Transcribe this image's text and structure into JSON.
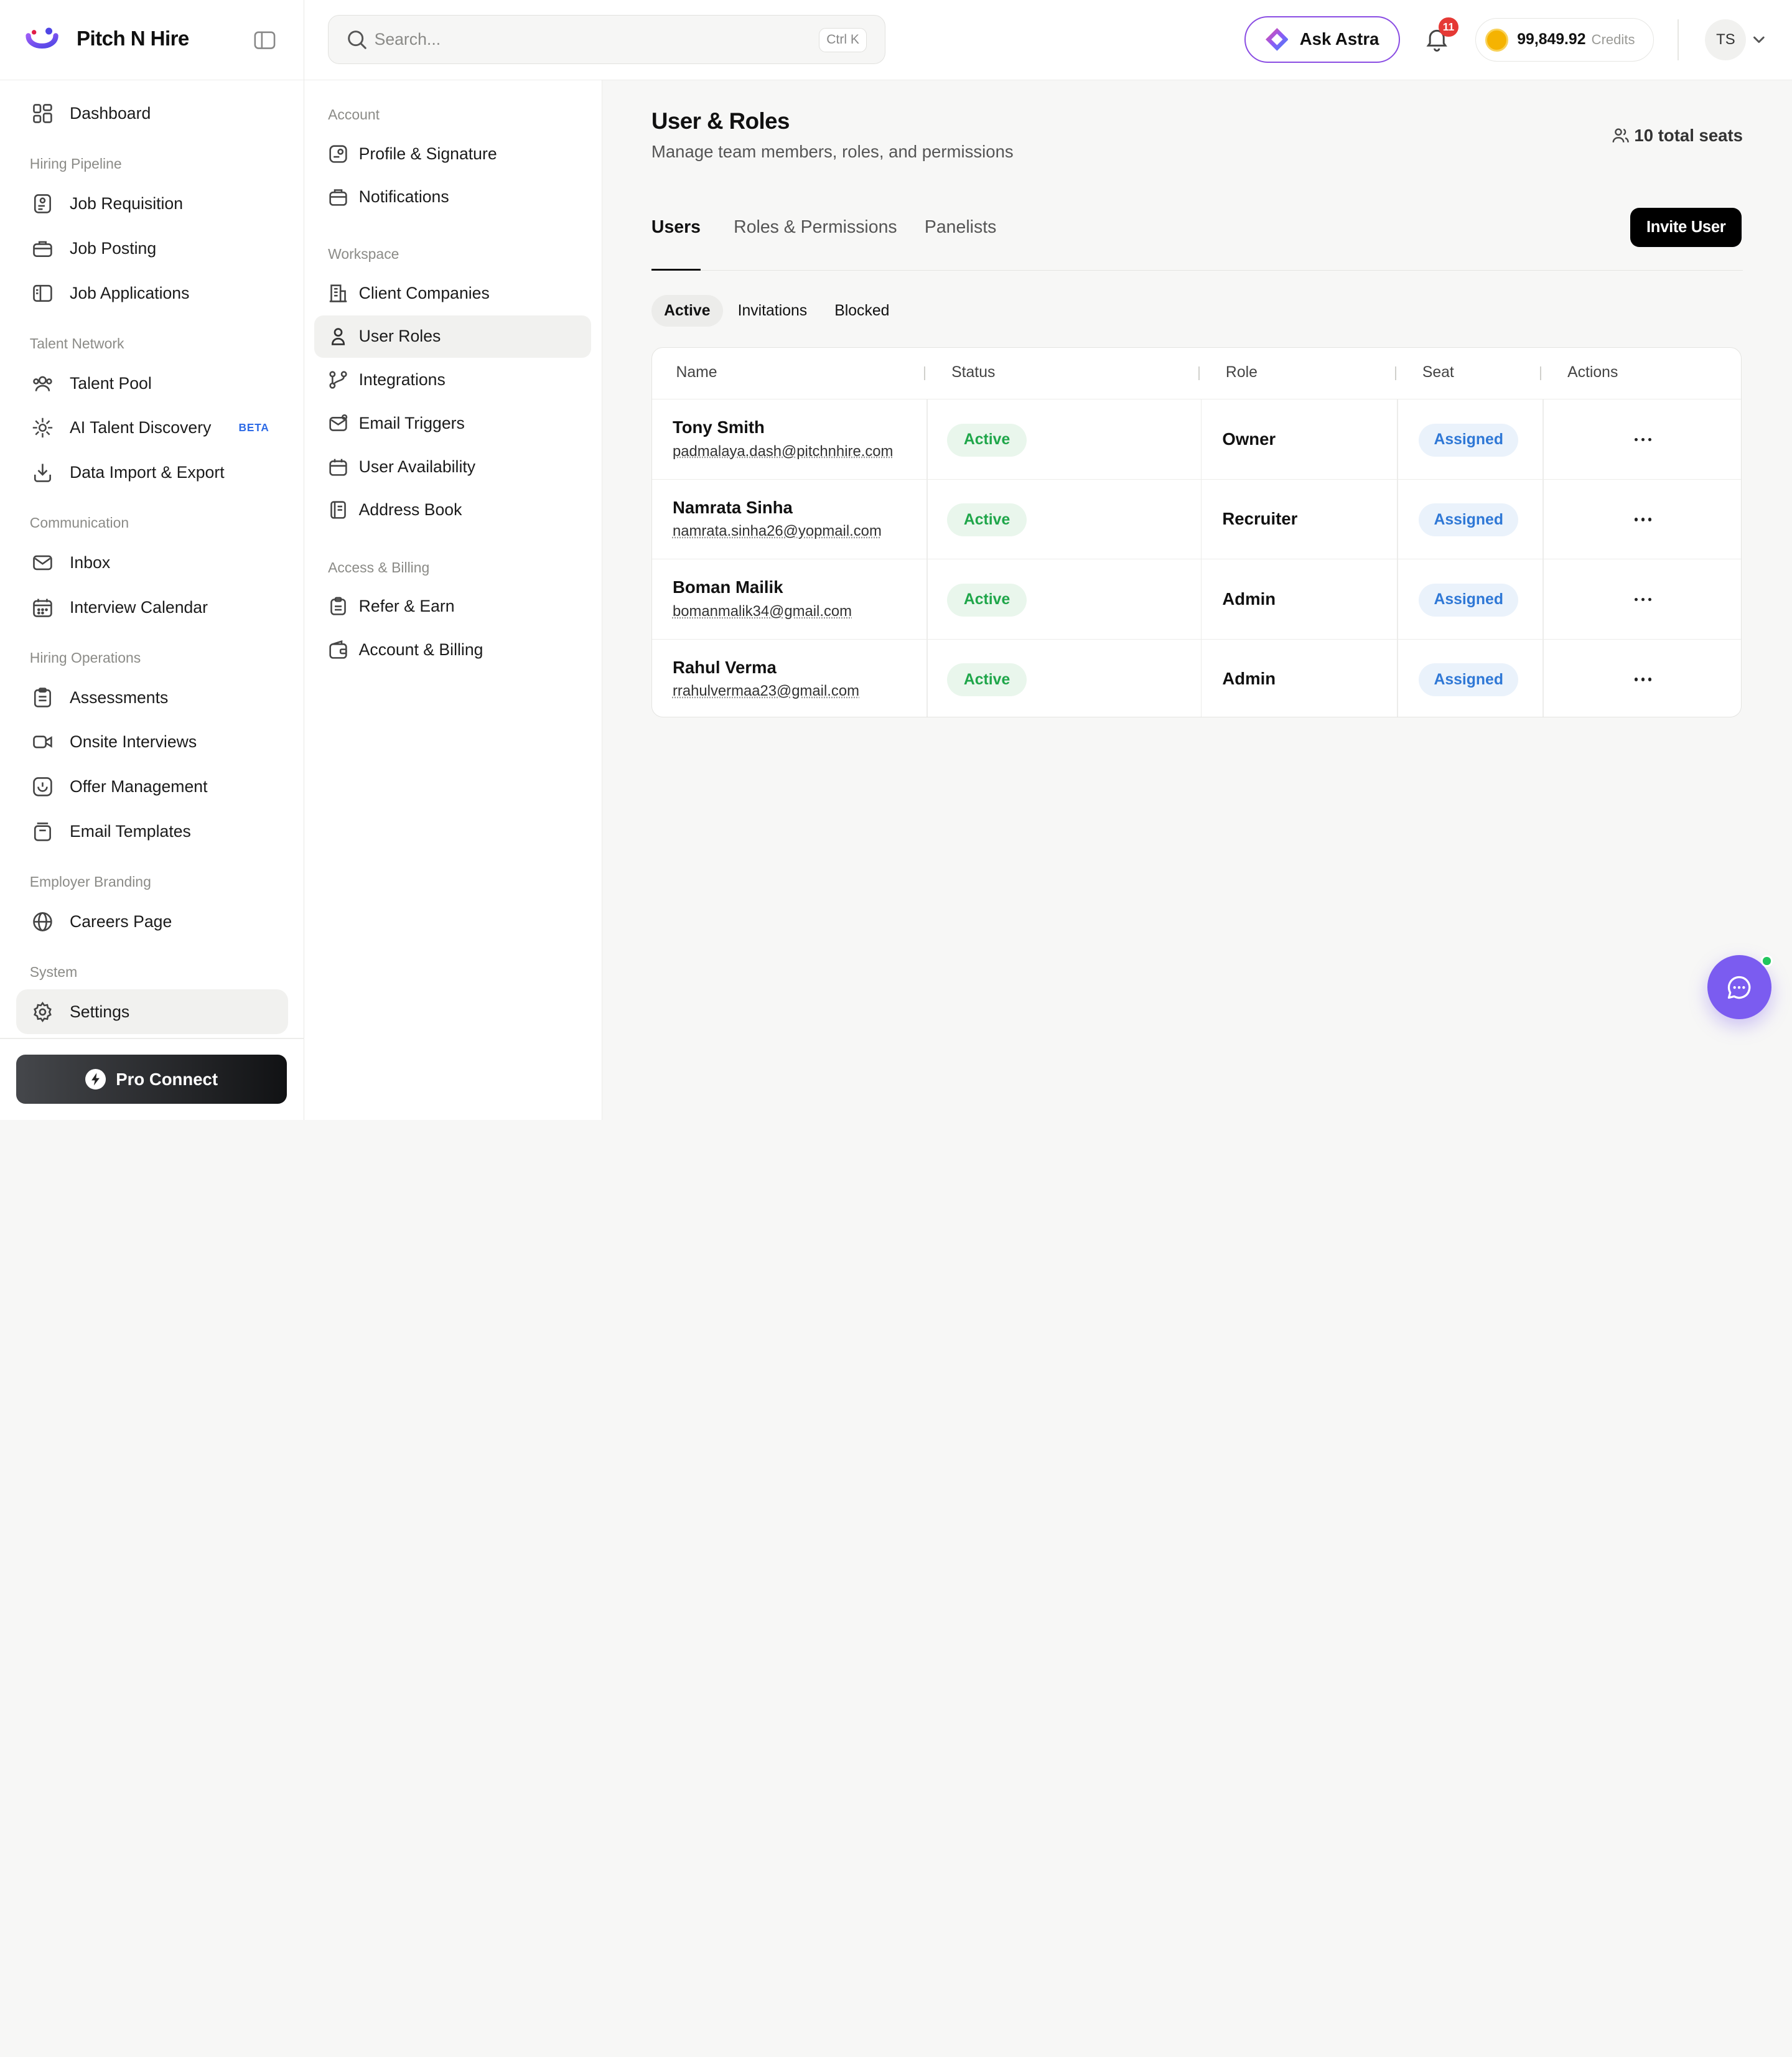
{
  "brand": {
    "name": "Pitch N Hire"
  },
  "sidebar": {
    "dashboard": "Dashboard",
    "sections": [
      {
        "title": "Hiring Pipeline",
        "items": [
          "Job Requisition",
          "Job Posting",
          "Job Applications"
        ]
      },
      {
        "title": "Talent Network",
        "items": [
          "Talent Pool",
          "AI Talent Discovery",
          "Data Import & Export"
        ],
        "beta_label": "BETA"
      },
      {
        "title": "Communication",
        "items": [
          "Inbox",
          "Interview Calendar"
        ]
      },
      {
        "title": "Hiring Operations",
        "items": [
          "Assessments",
          "Onsite Interviews",
          "Offer Management",
          "Email Templates"
        ]
      },
      {
        "title": "Employer Branding",
        "items": [
          "Careers Page"
        ]
      },
      {
        "title": "System",
        "items": [
          "Settings"
        ]
      }
    ],
    "pro_connect": "Pro Connect"
  },
  "topbar": {
    "search_placeholder": "Search...",
    "search_shortcut": "Ctrl K",
    "ask_astra": "Ask Astra",
    "notification_count": "11",
    "credits_amount": "99,849.92",
    "credits_label": "Credits",
    "user_initials": "TS"
  },
  "settings_nav": {
    "sections": [
      {
        "title": "Account",
        "items": [
          "Profile & Signature",
          "Notifications"
        ]
      },
      {
        "title": "Workspace",
        "items": [
          "Client Companies",
          "User Roles",
          "Integrations",
          "Email Triggers",
          "User Availability",
          "Address Book"
        ]
      },
      {
        "title": "Access & Billing",
        "items": [
          "Refer & Earn",
          "Account & Billing"
        ]
      }
    ]
  },
  "main": {
    "title": "User & Roles",
    "subtitle": "Manage team members, roles, and permissions",
    "seats": "10 total seats",
    "tabs": [
      "Users",
      "Roles & Permissions",
      "Panelists"
    ],
    "invite_button": "Invite User",
    "filters": [
      "Active",
      "Invitations",
      "Blocked"
    ],
    "table": {
      "headers": [
        "Name",
        "Status",
        "Role",
        "Seat",
        "Actions"
      ],
      "rows": [
        {
          "name": "Tony Smith",
          "email": "padmalaya.dash@pitchnhire.com",
          "status": "Active",
          "role": "Owner",
          "seat": "Assigned"
        },
        {
          "name": "Namrata Sinha",
          "email": "namrata.sinha26@yopmail.com",
          "status": "Active",
          "role": "Recruiter",
          "seat": "Assigned"
        },
        {
          "name": "Boman Mailik",
          "email": "bomanmalik34@gmail.com",
          "status": "Active",
          "role": "Admin",
          "seat": "Assigned"
        },
        {
          "name": "Rahul Verma",
          "email": "rrahulvermaa23@gmail.com",
          "status": "Active",
          "role": "Admin",
          "seat": "Assigned"
        }
      ]
    }
  },
  "colors": {
    "accent_purple": "#7b5cf0",
    "status_green": "#1fa64a",
    "seat_blue": "#2f78d6",
    "badge_red": "#e53935"
  }
}
